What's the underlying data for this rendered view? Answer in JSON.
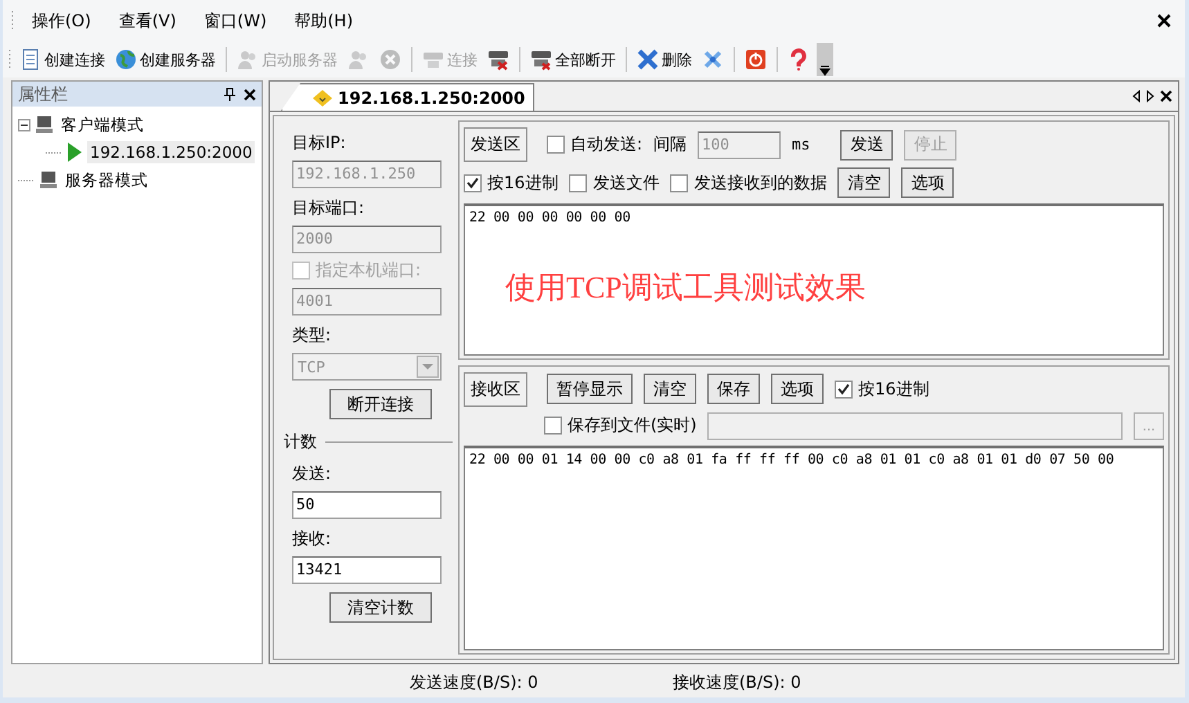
{
  "menu": [
    {
      "label": "操作(O)"
    },
    {
      "label": "查看(V)"
    },
    {
      "label": "窗口(W)"
    },
    {
      "label": "帮助(H)"
    }
  ],
  "toolbar": [
    {
      "kind": "button",
      "label": "创建连接",
      "disabled": false
    },
    {
      "kind": "button",
      "label": "创建服务器",
      "disabled": false
    },
    {
      "kind": "separator"
    },
    {
      "kind": "button",
      "label": "启动服务器",
      "disabled": true
    },
    {
      "kind": "icon",
      "disabled": true
    },
    {
      "kind": "icon",
      "disabled": true
    },
    {
      "kind": "separator"
    },
    {
      "kind": "button",
      "label": "连接",
      "disabled": true
    },
    {
      "kind": "icon",
      "disabled": false
    },
    {
      "kind": "separator"
    },
    {
      "kind": "button",
      "label": "全部断开",
      "disabled": false
    },
    {
      "kind": "separator"
    },
    {
      "kind": "button",
      "label": "删除",
      "disabled": false
    },
    {
      "kind": "icon",
      "disabled": false
    },
    {
      "kind": "separator"
    },
    {
      "kind": "icon",
      "disabled": false
    },
    {
      "kind": "separator"
    },
    {
      "kind": "icon",
      "disabled": false
    }
  ],
  "sidebar": {
    "title": "属性栏",
    "tree": [
      {
        "label": "客户端模式",
        "expanded": true,
        "children": [
          {
            "label": "192.168.1.250:2000",
            "selected": true
          }
        ]
      },
      {
        "label": "服务器模式"
      }
    ]
  },
  "document_tab": {
    "label": "192.168.1.250:2000",
    "selected": true
  },
  "params": [
    {
      "kind": "label",
      "label": "目标IP:"
    },
    {
      "kind": "field",
      "value": "192.168.1.250",
      "disabled": true
    },
    {
      "kind": "label",
      "label": "目标端口:"
    },
    {
      "kind": "field",
      "value": "2000",
      "disabled": true
    },
    {
      "kind": "checkbox",
      "label": "指定本机端口:",
      "checked": false,
      "disabled": true
    },
    {
      "kind": "field",
      "value": "4001",
      "disabled": true
    },
    {
      "kind": "label",
      "label": "类型:"
    },
    {
      "kind": "select",
      "value": "TCP",
      "disabled": true
    },
    {
      "kind": "button",
      "label": "断开连接",
      "disabled": false
    },
    {
      "kind": "group",
      "label": "计数"
    },
    {
      "kind": "label",
      "label": "发送:"
    },
    {
      "kind": "field",
      "value": "50",
      "disabled": false
    },
    {
      "kind": "label",
      "label": "接收:"
    },
    {
      "kind": "field",
      "value": "13421",
      "disabled": false
    },
    {
      "kind": "button",
      "label": "清空计数",
      "disabled": false
    }
  ],
  "send": {
    "header_controls": [
      {
        "kind": "area",
        "label": "发送区"
      },
      {
        "kind": "checkbox",
        "label": "自动发送:",
        "checked": false,
        "disabled": false
      },
      {
        "kind": "text",
        "label": "间隔"
      },
      {
        "kind": "field",
        "value": "100",
        "disabled": true
      },
      {
        "kind": "unit",
        "label": "ms"
      },
      {
        "kind": "button",
        "label": "发送",
        "disabled": false
      },
      {
        "kind": "button",
        "label": "停止",
        "disabled": true
      }
    ],
    "option_controls": [
      {
        "kind": "checkbox",
        "label": "按16进制",
        "checked": true,
        "disabled": false
      },
      {
        "kind": "checkbox",
        "label": "发送文件",
        "checked": false,
        "disabled": false
      },
      {
        "kind": "checkbox",
        "label": "发送接收到的数据",
        "checked": false,
        "disabled": false
      },
      {
        "kind": "button",
        "label": "清空",
        "disabled": false
      },
      {
        "kind": "button",
        "label": "选项",
        "disabled": false
      }
    ],
    "content": "22 00 00 00 00 00 00",
    "annotation": "使用TCP调试工具测试效果"
  },
  "receive": {
    "header_controls": [
      {
        "kind": "area",
        "label": "接收区"
      },
      {
        "kind": "button",
        "label": "暂停显示",
        "disabled": false
      },
      {
        "kind": "button",
        "label": "清空",
        "disabled": false
      },
      {
        "kind": "button",
        "label": "保存",
        "disabled": false
      },
      {
        "kind": "button",
        "label": "选项",
        "disabled": false
      },
      {
        "kind": "checkbox",
        "label": "按16进制",
        "checked": true,
        "disabled": false
      }
    ],
    "option_controls": [
      {
        "kind": "checkbox",
        "label": "保存到文件(实时)",
        "checked": false,
        "disabled": false
      },
      {
        "kind": "path",
        "disabled": true
      },
      {
        "kind": "browse",
        "label": "...",
        "disabled": true
      }
    ],
    "content": "22 00 00 01 14 00 00 c0 a8 01 fa ff ff ff 00 c0 a8 01 01 c0 a8 01 01 d0 07 50 00"
  },
  "status_bar": [
    "发送速度(B/S): 0",
    "接收速度(B/S): 0"
  ]
}
